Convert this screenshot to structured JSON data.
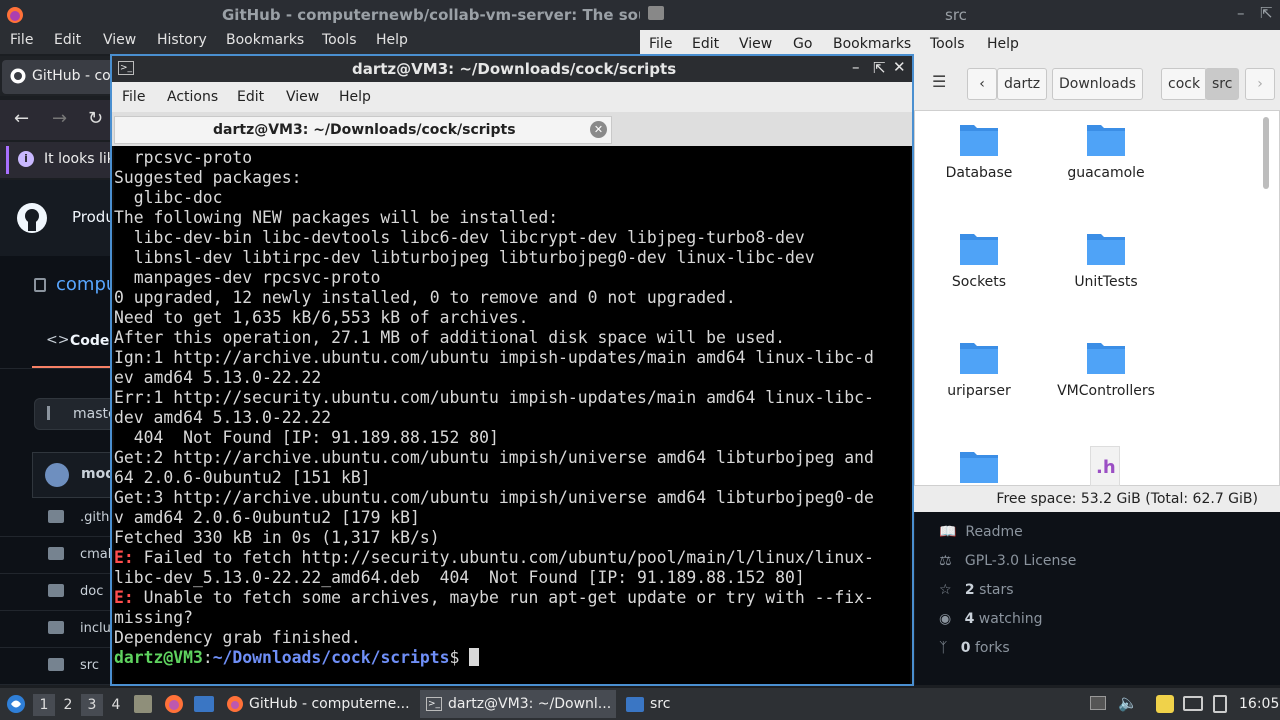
{
  "firefox": {
    "window_title": "GitHub - computernewb/collab-vm-server: The sou",
    "menu": [
      "File",
      "Edit",
      "View",
      "History",
      "Bookmarks",
      "Tools",
      "Help"
    ],
    "tab_label": "GitHub - co",
    "notification": "It looks lik",
    "header_item": "Produ",
    "repo_link": "compu",
    "code_tab": "Code",
    "branch": "maste",
    "commit_author": "mod",
    "files": [
      ".githu",
      "cmak",
      "doc",
      "inclu",
      "src"
    ],
    "sidebar": {
      "readme": "Readme",
      "license": "GPL-3.0 License",
      "stars_count": "2",
      "stars_label": "stars",
      "watching_count": "4",
      "watching_label": "watching",
      "forks_count": "0",
      "forks_label": "forks"
    }
  },
  "file_manager": {
    "window_title": "src",
    "menu": [
      "File",
      "Edit",
      "View",
      "Go",
      "Bookmarks",
      "Tools",
      "Help"
    ],
    "breadcrumbs": [
      "dartz",
      "Downloads",
      "cock",
      "src"
    ],
    "items": [
      "Database",
      "guacamole",
      "Sockets",
      "UnitTests",
      "uriparser",
      "VMControllers"
    ],
    "partial_file_glyph": ".h",
    "status": "Free space: 53.2 GiB (Total: 62.7 GiB)"
  },
  "terminal": {
    "window_title": "dartz@VM3: ~/Downloads/cock/scripts",
    "menu": [
      "File",
      "Actions",
      "Edit",
      "View",
      "Help"
    ],
    "tab_title": "dartz@VM3: ~/Downloads/cock/scripts",
    "lines": [
      "  rpcsvc-proto",
      "Suggested packages:",
      "  glibc-doc",
      "The following NEW packages will be installed:",
      "  libc-dev-bin libc-devtools libc6-dev libcrypt-dev libjpeg-turbo8-dev",
      "  libnsl-dev libtirpc-dev libturbojpeg libturbojpeg0-dev linux-libc-dev",
      "  manpages-dev rpcsvc-proto",
      "0 upgraded, 12 newly installed, 0 to remove and 0 not upgraded.",
      "Need to get 1,635 kB/6,553 kB of archives.",
      "After this operation, 27.1 MB of additional disk space will be used.",
      "Ign:1 http://archive.ubuntu.com/ubuntu impish-updates/main amd64 linux-libc-d",
      "ev amd64 5.13.0-22.22",
      "Err:1 http://security.ubuntu.com/ubuntu impish-updates/main amd64 linux-libc-",
      "dev amd64 5.13.0-22.22",
      "  404  Not Found [IP: 91.189.88.152 80]",
      "Get:2 http://archive.ubuntu.com/ubuntu impish/universe amd64 libturbojpeg and",
      "64 2.0.6-0ubuntu2 [151 kB]",
      "Get:3 http://archive.ubuntu.com/ubuntu impish/universe amd64 libturbojpeg0-de",
      "v amd64 2.0.6-0ubuntu2 [179 kB]",
      "Fetched 330 kB in 0s (1,317 kB/s)"
    ],
    "error1_prefix": "E:",
    "error1_a": " Failed to fetch http://security.ubuntu.com/ubuntu/pool/main/l/linux/linux-",
    "error1_b": "libc-dev_5.13.0-22.22_amd64.deb  404  Not Found [IP: 91.189.88.152 80]",
    "error2_prefix": "E:",
    "error2_a": " Unable to fetch some archives, maybe run apt-get update or try with --fix-",
    "error2_b": "missing?",
    "final_line": "Dependency grab finished.",
    "prompt_user": "dartz@VM3",
    "prompt_sep": ":",
    "prompt_path": "~/Downloads/cock/scripts",
    "prompt_char": "$ "
  },
  "taskbar": {
    "workspaces": [
      "1",
      "2",
      "3",
      "4"
    ],
    "tasks": [
      "GitHub - computerne...",
      "dartz@VM3: ~/Downl...",
      "src"
    ],
    "clock": "16:05"
  },
  "colors": {
    "terminal_error": "#ff4d4d",
    "prompt_user": "#5fd35f",
    "prompt_path": "#6f8ff7",
    "folder_blue": "#3b8ee6",
    "active_border": "#4a8fd0"
  }
}
